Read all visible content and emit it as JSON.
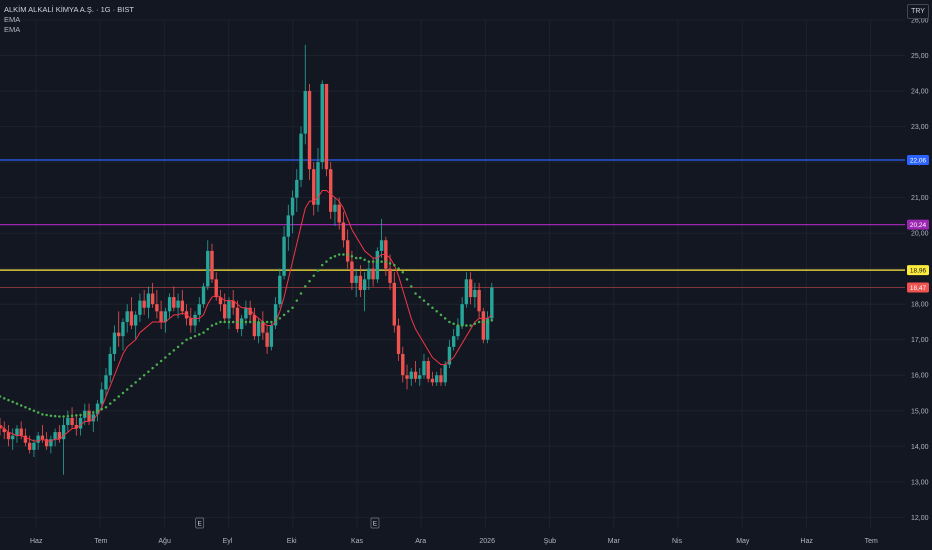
{
  "header": {
    "title": "ALKİM ALKALİ KİMYA A.Ş. · 1G · BIST",
    "indicators": [
      "EMA",
      "EMA"
    ],
    "currency": "TRY"
  },
  "colors": {
    "background": "#131722",
    "grid": "#1e222d",
    "up": "#26a69a",
    "down": "#ef5350",
    "ema_fast": "#f23645",
    "ema_slow": "#4caf50",
    "axis_text": "#b2b5be"
  },
  "chart_data": {
    "type": "candlestick",
    "ylim": [
      11.7,
      26.0
    ],
    "y_ticks": [
      "12,00",
      "13,00",
      "14,00",
      "15,00",
      "16,00",
      "17,00",
      "18,00",
      "19,00",
      "20,00",
      "21,00",
      "22,00",
      "23,00",
      "24,00",
      "25,00",
      "26,00"
    ],
    "x_labels": [
      "Haz",
      "Tem",
      "Ağu",
      "Eyl",
      "Eki",
      "Kas",
      "Ara",
      "2026",
      "Şub",
      "Mar",
      "Nis",
      "May",
      "Haz",
      "Tem"
    ],
    "horizontal_lines": [
      {
        "value": 22.06,
        "label": "22,06",
        "color": "#2962ff"
      },
      {
        "value": 20.24,
        "label": "20,24",
        "color": "#9c27b0"
      },
      {
        "value": 18.96,
        "label": "18,96",
        "color": "#ffeb3b"
      },
      {
        "value": 18.47,
        "label": "18,47",
        "color": "#ef5350",
        "style": "thin"
      }
    ],
    "event_markers": [
      {
        "label": "E",
        "month_index": 2.55
      },
      {
        "label": "E",
        "month_index": 5.28
      }
    ],
    "candles_start_index": 0,
    "candles_end_index": 7.1,
    "candles": [
      [
        14.6,
        14.8,
        14.3,
        14.5
      ],
      [
        14.5,
        14.7,
        14.2,
        14.4
      ],
      [
        14.4,
        14.6,
        14.0,
        14.2
      ],
      [
        14.2,
        14.5,
        13.9,
        14.3
      ],
      [
        14.3,
        14.6,
        14.1,
        14.5
      ],
      [
        14.5,
        14.7,
        14.2,
        14.3
      ],
      [
        14.3,
        14.5,
        14.0,
        14.1
      ],
      [
        14.1,
        14.3,
        13.8,
        13.9
      ],
      [
        13.9,
        14.2,
        13.7,
        14.1
      ],
      [
        14.1,
        14.4,
        13.9,
        14.3
      ],
      [
        14.3,
        14.6,
        14.1,
        14.2
      ],
      [
        14.2,
        14.4,
        13.9,
        14.0
      ],
      [
        14.0,
        14.3,
        13.8,
        14.2
      ],
      [
        14.2,
        14.5,
        14.0,
        14.4
      ],
      [
        14.4,
        14.6,
        14.1,
        14.2
      ],
      [
        14.2,
        14.8,
        13.2,
        14.6
      ],
      [
        14.6,
        15.0,
        14.4,
        14.8
      ],
      [
        14.8,
        15.1,
        14.5,
        14.6
      ],
      [
        14.6,
        14.9,
        14.3,
        14.5
      ],
      [
        14.5,
        14.9,
        14.3,
        14.8
      ],
      [
        14.8,
        15.2,
        14.6,
        15.0
      ],
      [
        15.0,
        15.2,
        14.6,
        14.7
      ],
      [
        14.7,
        15.0,
        14.4,
        14.9
      ],
      [
        14.9,
        15.3,
        14.7,
        15.2
      ],
      [
        15.2,
        15.8,
        15.0,
        15.6
      ],
      [
        15.6,
        16.2,
        15.4,
        16.0
      ],
      [
        16.0,
        16.8,
        15.8,
        16.6
      ],
      [
        16.6,
        17.4,
        16.4,
        17.2
      ],
      [
        17.2,
        17.8,
        16.8,
        17.1
      ],
      [
        17.1,
        17.6,
        16.7,
        17.5
      ],
      [
        17.5,
        18.0,
        17.2,
        17.8
      ],
      [
        17.8,
        18.2,
        17.3,
        17.4
      ],
      [
        17.4,
        17.8,
        17.0,
        17.7
      ],
      [
        17.7,
        18.3,
        17.5,
        18.1
      ],
      [
        18.1,
        18.4,
        17.7,
        17.9
      ],
      [
        17.9,
        18.5,
        17.6,
        18.3
      ],
      [
        18.3,
        18.6,
        17.9,
        18.0
      ],
      [
        18.0,
        18.4,
        17.6,
        17.8
      ],
      [
        17.8,
        18.1,
        17.3,
        17.5
      ],
      [
        17.5,
        17.9,
        17.2,
        17.8
      ],
      [
        17.8,
        18.3,
        17.6,
        18.2
      ],
      [
        18.2,
        18.5,
        17.8,
        17.9
      ],
      [
        17.9,
        18.3,
        17.6,
        18.1
      ],
      [
        18.1,
        18.4,
        17.7,
        17.8
      ],
      [
        17.8,
        18.0,
        17.4,
        17.6
      ],
      [
        17.6,
        17.9,
        17.2,
        17.4
      ],
      [
        17.4,
        17.8,
        17.2,
        17.7
      ],
      [
        17.7,
        18.2,
        17.5,
        18.0
      ],
      [
        18.0,
        18.6,
        17.9,
        18.5
      ],
      [
        18.5,
        19.8,
        18.4,
        19.5
      ],
      [
        19.5,
        19.7,
        18.6,
        18.7
      ],
      [
        18.7,
        18.9,
        18.1,
        18.2
      ],
      [
        18.2,
        18.4,
        17.8,
        18.0
      ],
      [
        18.0,
        18.3,
        17.5,
        17.6
      ],
      [
        17.6,
        18.2,
        17.3,
        18.1
      ],
      [
        18.1,
        18.4,
        17.7,
        17.9
      ],
      [
        17.9,
        18.1,
        17.2,
        17.3
      ],
      [
        17.3,
        17.7,
        17.1,
        17.6
      ],
      [
        17.6,
        18.1,
        17.4,
        17.9
      ],
      [
        17.9,
        18.1,
        17.5,
        17.7
      ],
      [
        17.7,
        17.9,
        17.0,
        17.1
      ],
      [
        17.1,
        17.6,
        16.9,
        17.5
      ],
      [
        17.5,
        17.8,
        17.0,
        17.2
      ],
      [
        17.2,
        17.4,
        16.6,
        16.8
      ],
      [
        16.8,
        17.5,
        16.7,
        17.4
      ],
      [
        17.4,
        18.2,
        17.3,
        18.0
      ],
      [
        18.0,
        19.0,
        17.9,
        18.8
      ],
      [
        18.8,
        20.2,
        18.7,
        19.9
      ],
      [
        19.9,
        20.8,
        19.5,
        20.5
      ],
      [
        20.5,
        21.2,
        20.0,
        21.0
      ],
      [
        21.0,
        21.8,
        20.6,
        21.5
      ],
      [
        21.5,
        23.0,
        21.3,
        22.8
      ],
      [
        22.8,
        25.3,
        22.5,
        24.0
      ],
      [
        24.0,
        24.2,
        21.5,
        21.8
      ],
      [
        21.8,
        22.0,
        20.5,
        20.8
      ],
      [
        20.8,
        22.4,
        20.6,
        22.0
      ],
      [
        22.0,
        24.3,
        21.8,
        24.2
      ],
      [
        24.2,
        24.2,
        21.6,
        21.8
      ],
      [
        21.8,
        22.0,
        20.4,
        20.6
      ],
      [
        20.6,
        21.0,
        20.2,
        20.8
      ],
      [
        20.8,
        21.0,
        20.1,
        20.3
      ],
      [
        20.3,
        20.6,
        19.6,
        19.8
      ],
      [
        19.8,
        20.1,
        19.0,
        19.2
      ],
      [
        19.2,
        19.5,
        18.4,
        18.6
      ],
      [
        18.6,
        19.0,
        18.2,
        18.8
      ],
      [
        18.8,
        19.1,
        18.2,
        18.4
      ],
      [
        18.4,
        18.9,
        17.8,
        18.7
      ],
      [
        18.7,
        19.2,
        18.4,
        19.0
      ],
      [
        19.0,
        19.3,
        18.5,
        18.7
      ],
      [
        18.7,
        19.6,
        18.6,
        19.5
      ],
      [
        19.5,
        20.4,
        19.3,
        19.8
      ],
      [
        19.8,
        19.9,
        18.8,
        19.0
      ],
      [
        19.0,
        19.4,
        18.4,
        18.6
      ],
      [
        18.6,
        18.9,
        17.2,
        17.4
      ],
      [
        17.4,
        17.6,
        16.4,
        16.6
      ],
      [
        16.6,
        16.8,
        15.8,
        16.0
      ],
      [
        16.0,
        16.3,
        15.6,
        15.9
      ],
      [
        15.9,
        16.2,
        15.7,
        16.1
      ],
      [
        16.1,
        16.4,
        15.8,
        15.9
      ],
      [
        15.9,
        16.2,
        15.7,
        16.0
      ],
      [
        16.0,
        16.6,
        15.9,
        16.4
      ],
      [
        16.4,
        16.5,
        15.8,
        15.9
      ],
      [
        15.9,
        16.1,
        15.7,
        15.8
      ],
      [
        15.8,
        16.1,
        15.7,
        16.0
      ],
      [
        16.0,
        16.2,
        15.7,
        15.8
      ],
      [
        15.8,
        16.4,
        15.7,
        16.3
      ],
      [
        16.3,
        17.0,
        16.2,
        16.8
      ],
      [
        16.8,
        17.3,
        16.7,
        17.1
      ],
      [
        17.1,
        17.6,
        17.0,
        17.4
      ],
      [
        17.4,
        18.2,
        17.3,
        18.0
      ],
      [
        18.0,
        18.9,
        17.9,
        18.7
      ],
      [
        18.7,
        18.9,
        18.0,
        18.2
      ],
      [
        18.2,
        18.6,
        17.9,
        18.4
      ],
      [
        18.4,
        18.6,
        17.6,
        17.8
      ],
      [
        17.8,
        17.9,
        16.9,
        17.0
      ],
      [
        17.0,
        17.8,
        16.9,
        17.6
      ],
      [
        17.6,
        18.6,
        17.5,
        18.47
      ]
    ],
    "ema_fast": [
      14.6,
      14.5,
      14.4,
      14.35,
      14.3,
      14.3,
      14.25,
      14.2,
      14.15,
      14.15,
      14.2,
      14.15,
      14.15,
      14.2,
      14.2,
      14.3,
      14.4,
      14.5,
      14.5,
      14.6,
      14.7,
      14.7,
      14.75,
      14.9,
      15.1,
      15.4,
      15.7,
      16.0,
      16.3,
      16.6,
      16.8,
      16.9,
      17.0,
      17.2,
      17.3,
      17.4,
      17.5,
      17.5,
      17.5,
      17.5,
      17.6,
      17.7,
      17.7,
      17.75,
      17.7,
      17.6,
      17.6,
      17.6,
      17.7,
      18.0,
      18.2,
      18.25,
      18.2,
      18.1,
      18.1,
      18.1,
      18.0,
      17.9,
      17.9,
      17.85,
      17.7,
      17.6,
      17.5,
      17.4,
      17.4,
      17.5,
      17.8,
      18.2,
      18.7,
      19.2,
      19.7,
      20.2,
      20.7,
      20.9,
      20.9,
      21.0,
      21.2,
      21.2,
      21.1,
      21.0,
      20.9,
      20.7,
      20.4,
      20.1,
      19.9,
      19.7,
      19.5,
      19.4,
      19.3,
      19.3,
      19.4,
      19.4,
      19.3,
      19.1,
      18.8,
      18.4,
      18.0,
      17.6,
      17.3,
      17.1,
      16.9,
      16.7,
      16.5,
      16.4,
      16.3,
      16.3,
      16.4,
      16.5,
      16.7,
      16.9,
      17.1,
      17.3,
      17.5,
      17.6,
      17.6,
      17.6,
      17.7
    ],
    "ema_slow": [
      15.4,
      15.35,
      15.3,
      15.25,
      15.2,
      15.15,
      15.1,
      15.05,
      15.0,
      14.95,
      14.9,
      14.88,
      14.86,
      14.85,
      14.84,
      14.84,
      14.85,
      14.86,
      14.87,
      14.88,
      14.9,
      14.92,
      14.95,
      15.0,
      15.05,
      15.1,
      15.2,
      15.3,
      15.4,
      15.5,
      15.6,
      15.7,
      15.8,
      15.9,
      16.0,
      16.1,
      16.2,
      16.3,
      16.4,
      16.5,
      16.6,
      16.7,
      16.8,
      16.9,
      17.0,
      17.05,
      17.1,
      17.15,
      17.2,
      17.3,
      17.4,
      17.45,
      17.5,
      17.5,
      17.5,
      17.5,
      17.5,
      17.5,
      17.5,
      17.5,
      17.5,
      17.5,
      17.5,
      17.5,
      17.5,
      17.55,
      17.6,
      17.7,
      17.8,
      17.9,
      18.1,
      18.3,
      18.5,
      18.65,
      18.8,
      18.95,
      19.1,
      19.2,
      19.3,
      19.35,
      19.4,
      19.4,
      19.4,
      19.35,
      19.3,
      19.3,
      19.25,
      19.2,
      19.2,
      19.2,
      19.2,
      19.2,
      19.15,
      19.1,
      19.0,
      18.9,
      18.7,
      18.5,
      18.3,
      18.2,
      18.1,
      18.0,
      17.9,
      17.8,
      17.7,
      17.6,
      17.5,
      17.45,
      17.4,
      17.4,
      17.4,
      17.4,
      17.45,
      17.5,
      17.5,
      17.5,
      17.55
    ]
  }
}
